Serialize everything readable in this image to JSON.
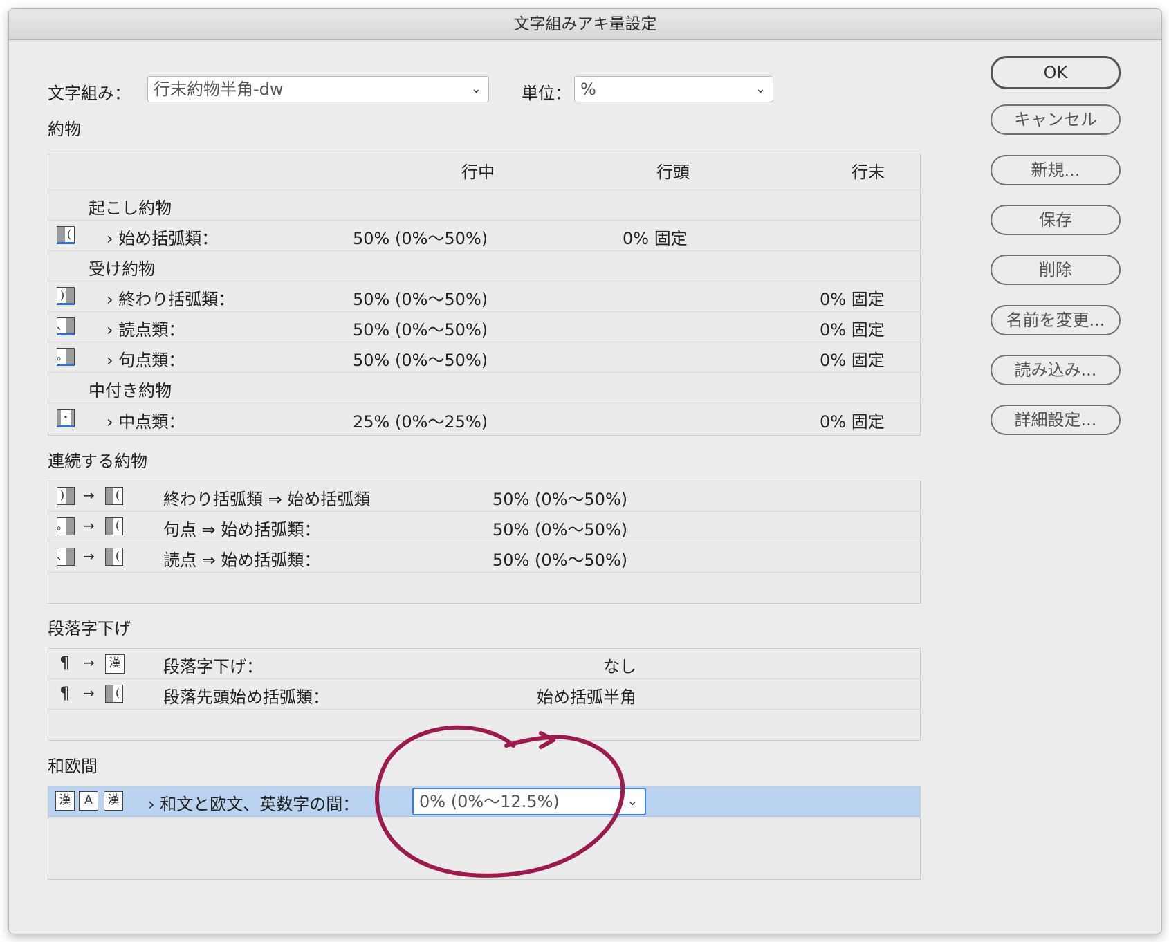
{
  "window": {
    "title": "文字組みアキ量設定"
  },
  "header": {
    "mojikumi_label": "文字組み：",
    "mojikumi_value": "行末約物半角-dw",
    "unit_label": "単位：",
    "unit_value": "%"
  },
  "yakumono": {
    "section_label": "約物",
    "columns": [
      "行中",
      "行頭",
      "行末"
    ],
    "groups": [
      "起こし約物",
      "受け約物",
      "中付き約物"
    ],
    "rows": [
      {
        "label": "› 始め括弧類：",
        "mid": "50% (0%〜50%)",
        "start": "0% 固定",
        "end": ""
      },
      {
        "label": "› 終わり括弧類：",
        "mid": "50% (0%〜50%)",
        "start": "",
        "end": "0% 固定"
      },
      {
        "label": "› 読点類：",
        "mid": "50% (0%〜50%)",
        "start": "",
        "end": "0% 固定"
      },
      {
        "label": "› 句点類：",
        "mid": "50% (0%〜50%)",
        "start": "",
        "end": "0% 固定"
      },
      {
        "label": "› 中点類：",
        "mid": "25% (0%〜25%)",
        "start": "",
        "end": "0% 固定"
      }
    ]
  },
  "renzoku": {
    "section_label": "連続する約物",
    "rows": [
      {
        "label": "終わり括弧類 ⇒ 始め括弧類",
        "value": "50% (0%〜50%)"
      },
      {
        "label": "句点 ⇒ 始め括弧類：",
        "value": "50% (0%〜50%)"
      },
      {
        "label": "読点 ⇒ 始め括弧類：",
        "value": "50% (0%〜50%)"
      }
    ]
  },
  "indent": {
    "section_label": "段落字下げ",
    "rows": [
      {
        "label": "段落字下げ：",
        "value": "なし"
      },
      {
        "label": "段落先頭始め括弧類：",
        "value": "始め括弧半角"
      }
    ]
  },
  "waou": {
    "section_label": "和欧間",
    "row_label": "› 和文と欧文、英数字の間：",
    "value": "0% (0%〜12.5%)"
  },
  "icons": {
    "kanji": "漢",
    "alpha": "A",
    "pilcrow": "¶",
    "arrow": "→",
    "open_paren": "(",
    "close_paren": ")",
    "comma": "、",
    "period": "。",
    "nakaguro": "・"
  },
  "buttons": {
    "ok": "OK",
    "cancel": "キャンセル",
    "new": "新規...",
    "save": "保存",
    "delete": "削除",
    "rename": "名前を変更...",
    "import": "読み込み...",
    "advanced": "詳細設定..."
  },
  "colors": {
    "accent": "#3b7ee6",
    "selection": "#b9d3f0",
    "annotation": "#9c1b4e"
  }
}
